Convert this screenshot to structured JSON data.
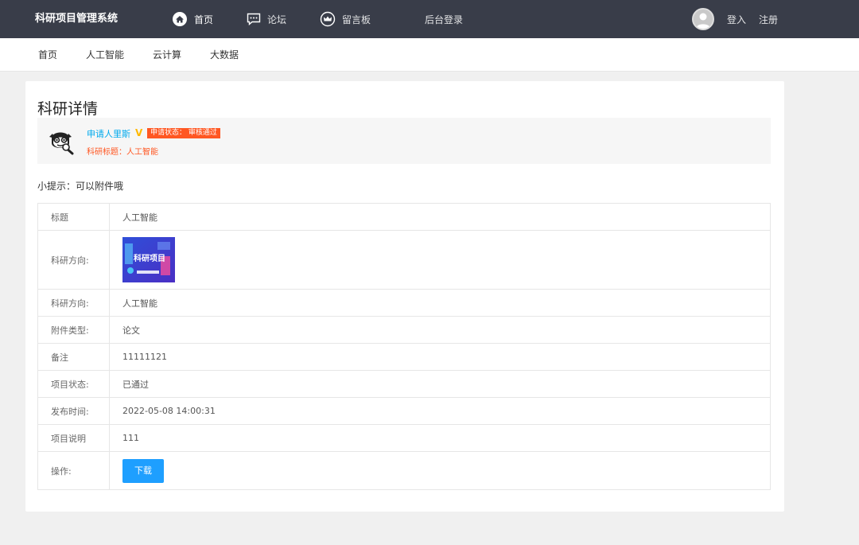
{
  "header": {
    "brand": "科研项目管理系统",
    "nav": [
      {
        "label": "首页",
        "icon": "home-icon"
      },
      {
        "label": "论坛",
        "icon": "chat-icon"
      },
      {
        "label": "留言板",
        "icon": "crown-icon"
      },
      {
        "label": "后台登录"
      }
    ],
    "login": "登入",
    "register": "注册"
  },
  "subnav": [
    "首页",
    "人工智能",
    "云计算",
    "大数据"
  ],
  "detail": {
    "title": "科研详情",
    "applicant": {
      "name": "申请人里斯",
      "status_badge": "申请状态： 审核通过",
      "topic": "科研标题：人工智能"
    },
    "tip": "小提示：可以附件哦",
    "rows": [
      {
        "key": "标题",
        "value": "人工智能"
      },
      {
        "key": "科研方向:",
        "image_text": "科研项目"
      },
      {
        "key": "科研方向:",
        "value": "人工智能"
      },
      {
        "key": "附件类型:",
        "value": "论文"
      },
      {
        "key": "备注",
        "value": "11111121"
      },
      {
        "key": "项目状态:",
        "value": "已通过"
      },
      {
        "key": "发布时间:",
        "value": "2022-05-08 14:00:31"
      },
      {
        "key": "项目说明",
        "value": "111"
      },
      {
        "key": "操作:",
        "button": "下载"
      }
    ]
  },
  "colors": {
    "topbar": "#393d49",
    "link": "#01aaed",
    "badge": "#ff5722",
    "verified": "#ffb800",
    "button": "#1e9fff"
  }
}
